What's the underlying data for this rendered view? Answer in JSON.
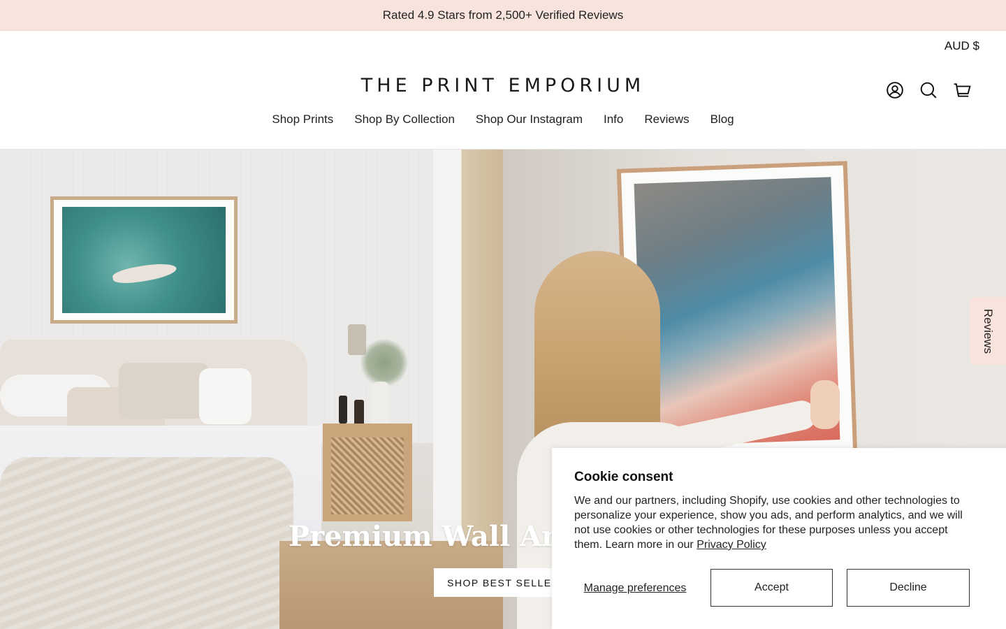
{
  "announcement": "Rated 4.9 Stars from 2,500+ Verified Reviews",
  "header": {
    "currency": "AUD $",
    "logo": "THE PRINT EMPORIUM",
    "icons": [
      "account-icon",
      "search-icon",
      "cart-icon"
    ]
  },
  "nav": [
    "Shop Prints",
    "Shop By Collection",
    "Shop Our Instagram",
    "Info",
    "Reviews",
    "Blog"
  ],
  "hero": {
    "title": "Premium Wall Art, Ma",
    "button": "SHOP BEST SELLER"
  },
  "reviews_tab": "Reviews",
  "cookie": {
    "title": "Cookie consent",
    "body": "We and our partners, including Shopify, use cookies and other technologies to personalize your experience, show you ads, and perform analytics, and we will not use cookies or other technologies for these purposes unless you accept them. Learn more in our ",
    "link": "Privacy Policy",
    "manage": "Manage preferences",
    "accept": "Accept",
    "decline": "Decline"
  }
}
